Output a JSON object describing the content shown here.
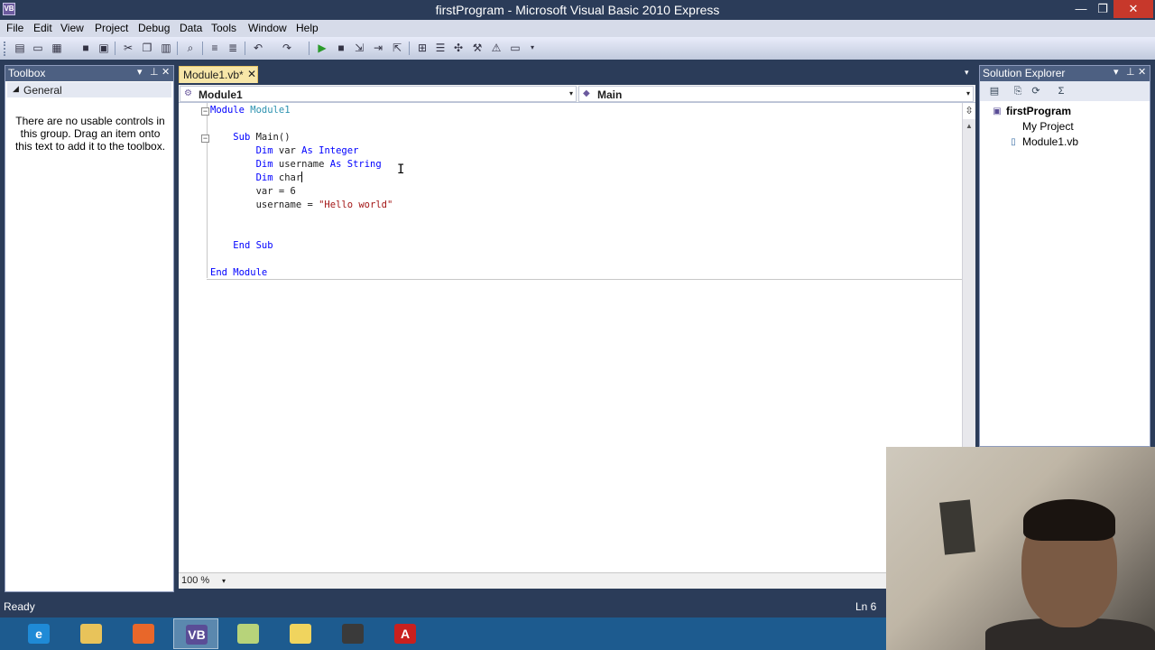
{
  "window": {
    "title": "firstProgram - Microsoft Visual Basic 2010 Express",
    "app_icon": "VB",
    "minimize": "—",
    "maximize": "❐",
    "close": "✕"
  },
  "menu": [
    "File",
    "Edit",
    "View",
    "Project",
    "Debug",
    "Data",
    "Tools",
    "Window",
    "Help"
  ],
  "toolbar_icons": [
    "new-project-icon",
    "open-icon",
    "add-item-icon",
    "save-icon",
    "save-all-icon",
    "cut-icon",
    "copy-icon",
    "paste-icon",
    "find-icon",
    "comment-icon",
    "uncomment-icon",
    "undo-icon",
    "redo-icon",
    "start-debugging-icon",
    "stop-icon",
    "step-into-icon",
    "step-over-icon",
    "step-out-icon",
    "solution-explorer-icon",
    "properties-icon",
    "object-browser-icon",
    "toolbox-icon",
    "error-list-icon"
  ],
  "toolbox": {
    "title": "Toolbox",
    "group": "General",
    "message": "There are no usable controls in this group. Drag an item onto this text to add it to the toolbox."
  },
  "document": {
    "tab_label": "Module1.vb*",
    "nav_left": "Module1",
    "nav_right": "Main",
    "zoom": "100 %"
  },
  "code_lines": [
    {
      "parts": [
        [
          "kw",
          "Module"
        ],
        [
          "",
          " "
        ],
        [
          "ty",
          "Module1"
        ]
      ]
    },
    {
      "parts": []
    },
    {
      "parts": [
        [
          "",
          "    "
        ],
        [
          "kw",
          "Sub"
        ],
        [
          "",
          " Main()"
        ]
      ]
    },
    {
      "parts": [
        [
          "",
          "        "
        ],
        [
          "kw",
          "Dim"
        ],
        [
          "",
          " var "
        ],
        [
          "kw",
          "As"
        ],
        [
          "",
          ""
        ],
        [
          "kw",
          " Integer"
        ]
      ]
    },
    {
      "parts": [
        [
          "",
          "        "
        ],
        [
          "kw",
          "Dim"
        ],
        [
          "",
          " username "
        ],
        [
          "kw",
          "As"
        ],
        [
          "kw",
          " String"
        ]
      ]
    },
    {
      "parts": [
        [
          "",
          "        "
        ],
        [
          "kw",
          "Dim"
        ],
        [
          "",
          " char"
        ]
      ]
    },
    {
      "parts": [
        [
          "",
          "        var = 6"
        ]
      ]
    },
    {
      "parts": [
        [
          "",
          "        username = "
        ],
        [
          "st",
          "\"Hello world\""
        ]
      ]
    },
    {
      "parts": []
    },
    {
      "parts": []
    },
    {
      "parts": [
        [
          "",
          "    "
        ],
        [
          "kw",
          "End"
        ],
        [
          "",
          ""
        ],
        [
          "kw",
          " Sub"
        ]
      ]
    },
    {
      "parts": []
    },
    {
      "parts": [
        [
          "kw",
          "End"
        ],
        [
          "kw",
          " Module"
        ]
      ]
    }
  ],
  "solution_explorer": {
    "title": "Solution Explorer",
    "project": "firstProgram",
    "items": [
      "My Project",
      "Module1.vb"
    ]
  },
  "status": {
    "left": "Ready",
    "right": "Ln 6"
  },
  "taskbar_apps": [
    {
      "name": "internet-explorer-icon",
      "glyph": "e",
      "color": "#1f8ad6"
    },
    {
      "name": "file-explorer-icon",
      "glyph": "",
      "color": "#e8c35a"
    },
    {
      "name": "firefox-icon",
      "glyph": "",
      "color": "#e8672a"
    },
    {
      "name": "visual-basic-icon",
      "glyph": "VB",
      "color": "#5a4d96"
    },
    {
      "name": "notes-icon",
      "glyph": "",
      "color": "#b7d37a"
    },
    {
      "name": "folder-icon",
      "glyph": "",
      "color": "#f0d45e"
    },
    {
      "name": "camera-app-icon",
      "glyph": "",
      "color": "#3a3a3a"
    },
    {
      "name": "adobe-reader-icon",
      "glyph": "A",
      "color": "#c9201e"
    }
  ]
}
